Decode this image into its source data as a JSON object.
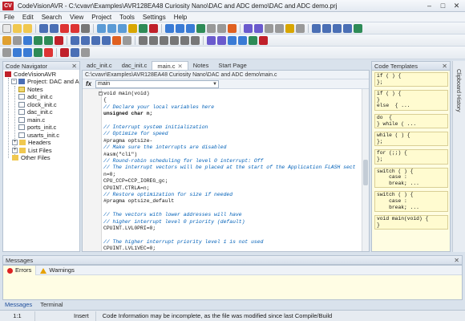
{
  "window": {
    "logo": "CV",
    "title": "CodeVisionAVR - C:\\cvavr\\Examples\\AVR128EA48 Curiosity Nano\\DAC and ADC demo\\DAC and ADC demo.prj"
  },
  "menu": [
    "File",
    "Edit",
    "Search",
    "View",
    "Project",
    "Tools",
    "Settings",
    "Help"
  ],
  "navigator": {
    "title": "Code Navigator",
    "items": [
      {
        "label": "CodeVisionAVR"
      },
      {
        "label": "Project: DAC and ADC d"
      },
      {
        "label": "Notes"
      },
      {
        "label": "adc_init.c"
      },
      {
        "label": "clock_init.c"
      },
      {
        "label": "dac_init.c"
      },
      {
        "label": "main.c"
      },
      {
        "label": "ports_init.c"
      },
      {
        "label": "usarts_init.c"
      },
      {
        "label": "Headers"
      },
      {
        "label": "List Files"
      },
      {
        "label": "Other Files"
      }
    ]
  },
  "tabs": [
    {
      "label": "adc_init.c"
    },
    {
      "label": "dac_init.c"
    },
    {
      "label": "main.c"
    },
    {
      "label": "Notes"
    },
    {
      "label": "Start Page"
    }
  ],
  "editor": {
    "path": "C:\\cvavr\\Examples\\AVR128EA48 Curiosity Nano\\DAC and ADC demo\\main.c",
    "fx": "fx",
    "function": "main",
    "lines": [
      {
        "t": "void main(void)",
        "c": "plain"
      },
      {
        "t": "{",
        "c": "plain"
      },
      {
        "t": "// Declare your local variables here",
        "c": "comment"
      },
      {
        "t": "unsigned char n;",
        "c": "kw"
      },
      {
        "t": "",
        "c": "plain"
      },
      {
        "t": "// Interrupt system initialization",
        "c": "comment"
      },
      {
        "t": "// Optimize for speed",
        "c": "comment"
      },
      {
        "t": "#pragma optsize-",
        "c": "plain"
      },
      {
        "t": "// Make sure the interrupts are disabled",
        "c": "comment"
      },
      {
        "t": "#asm(\"cli\")",
        "c": "plain"
      },
      {
        "t": "// Round-robin scheduling for level 0 interrupt: Off",
        "c": "comment"
      },
      {
        "t": "// The interrupt vectors will be placed at the start of the Application FLASH sect",
        "c": "comment"
      },
      {
        "t": "n=0;",
        "c": "plain"
      },
      {
        "t": "CPU_CCP=CCP_IOREG_gc;",
        "c": "plain"
      },
      {
        "t": "CPUINT.CTRLA=n;",
        "c": "plain"
      },
      {
        "t": "// Restore optimization for size if needed",
        "c": "comment"
      },
      {
        "t": "#pragma optsize_default",
        "c": "plain"
      },
      {
        "t": "",
        "c": "plain"
      },
      {
        "t": "// The vectors with lower addresses will have",
        "c": "comment"
      },
      {
        "t": "// higher interrupt level 0 priority (default)",
        "c": "comment"
      },
      {
        "t": "CPUINT.LVL0PRI=0;",
        "c": "plain"
      },
      {
        "t": "",
        "c": "plain"
      },
      {
        "t": "// The higher interrupt priority level 1 is not used",
        "c": "comment"
      },
      {
        "t": "CPUINT.LVL1VEC=0;",
        "c": "plain"
      }
    ]
  },
  "templates": {
    "title": "Code Templates",
    "items": [
      {
        "code": "if ( ) {\n};"
      },
      {
        "code": "if ( ) {\n}\nelse  { ..."
      },
      {
        "code": "do  {\n} while ( ... "
      },
      {
        "code": "while ( ) {\n};"
      },
      {
        "code": "for (;;) {\n};"
      },
      {
        "code": "switch ( ) {\n    case :\n    break; ..."
      },
      {
        "code": "switch ( ) {\n    case :\n    break; ..."
      },
      {
        "code": "void main(void) {\n}"
      }
    ]
  },
  "side_panel": {
    "label": "Clipboard History"
  },
  "messages": {
    "title": "Messages",
    "tabs": [
      {
        "label": "Errors"
      },
      {
        "label": "Warnings"
      }
    ]
  },
  "bottom_tabs": [
    {
      "label": "Messages"
    },
    {
      "label": "Terminal"
    }
  ],
  "status": {
    "position": "1:1",
    "mode": "Insert",
    "message": "Code Information may be incomplete, as the file was modified since last Compile/Build"
  }
}
